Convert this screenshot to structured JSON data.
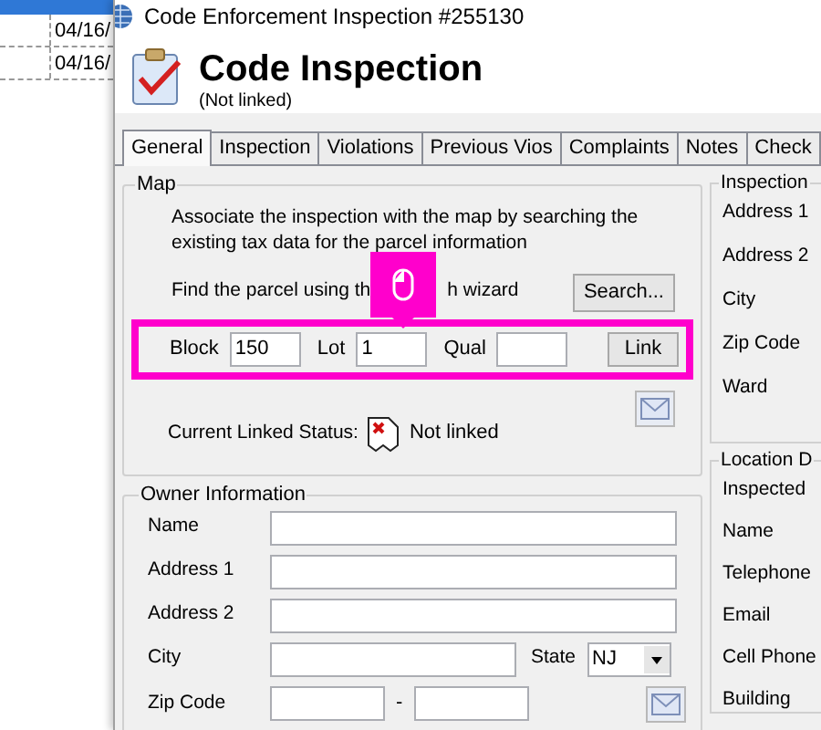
{
  "background_app": {
    "rows": [
      {
        "date": "04/16/"
      },
      {
        "date": "04/16/"
      }
    ]
  },
  "window": {
    "title": "Code Enforcement Inspection #255130"
  },
  "header": {
    "title": "Code Inspection",
    "subtitle": "(Not linked)"
  },
  "tabs": [
    {
      "label": "General",
      "selected": true
    },
    {
      "label": "Inspection",
      "selected": false
    },
    {
      "label": "Violations",
      "selected": false
    },
    {
      "label": "Previous Vios",
      "selected": false
    },
    {
      "label": "Complaints",
      "selected": false
    },
    {
      "label": "Notes",
      "selected": false
    },
    {
      "label": "Check",
      "selected": false
    }
  ],
  "map": {
    "legend": "Map",
    "description": "Associate the inspection with the map by searching the existing tax data for the parcel information",
    "find_text_before": "Find the parcel using th",
    "find_text_after": "h wizard",
    "search_button": "Search...",
    "fields": [
      {
        "label": "Block",
        "value": "150"
      },
      {
        "label": "Lot",
        "value": "1"
      },
      {
        "label": "Qual"
      }
    ],
    "link_button": "Link",
    "status_label": "Current Linked Status:",
    "status_value": "Not linked"
  },
  "owner": {
    "legend": "Owner Information",
    "rows": [
      {
        "kind": "text",
        "label": "Name"
      },
      {
        "kind": "text",
        "label": "Address 1"
      },
      {
        "kind": "text",
        "label": "Address 2"
      },
      {
        "kind": "city",
        "label": "City",
        "state_label": "State",
        "state_value": "NJ"
      },
      {
        "kind": "zip",
        "label": "Zip Code",
        "separator": "-"
      }
    ]
  },
  "inspection_group": {
    "legend": "Inspection",
    "labels": [
      "Address 1",
      "Address 2",
      "City",
      "Zip Code",
      "Ward"
    ]
  },
  "location_group": {
    "legend": "Location D",
    "labels": [
      "Inspected",
      "Name",
      "Telephone",
      "Email",
      "Cell Phone",
      "Building"
    ]
  }
}
